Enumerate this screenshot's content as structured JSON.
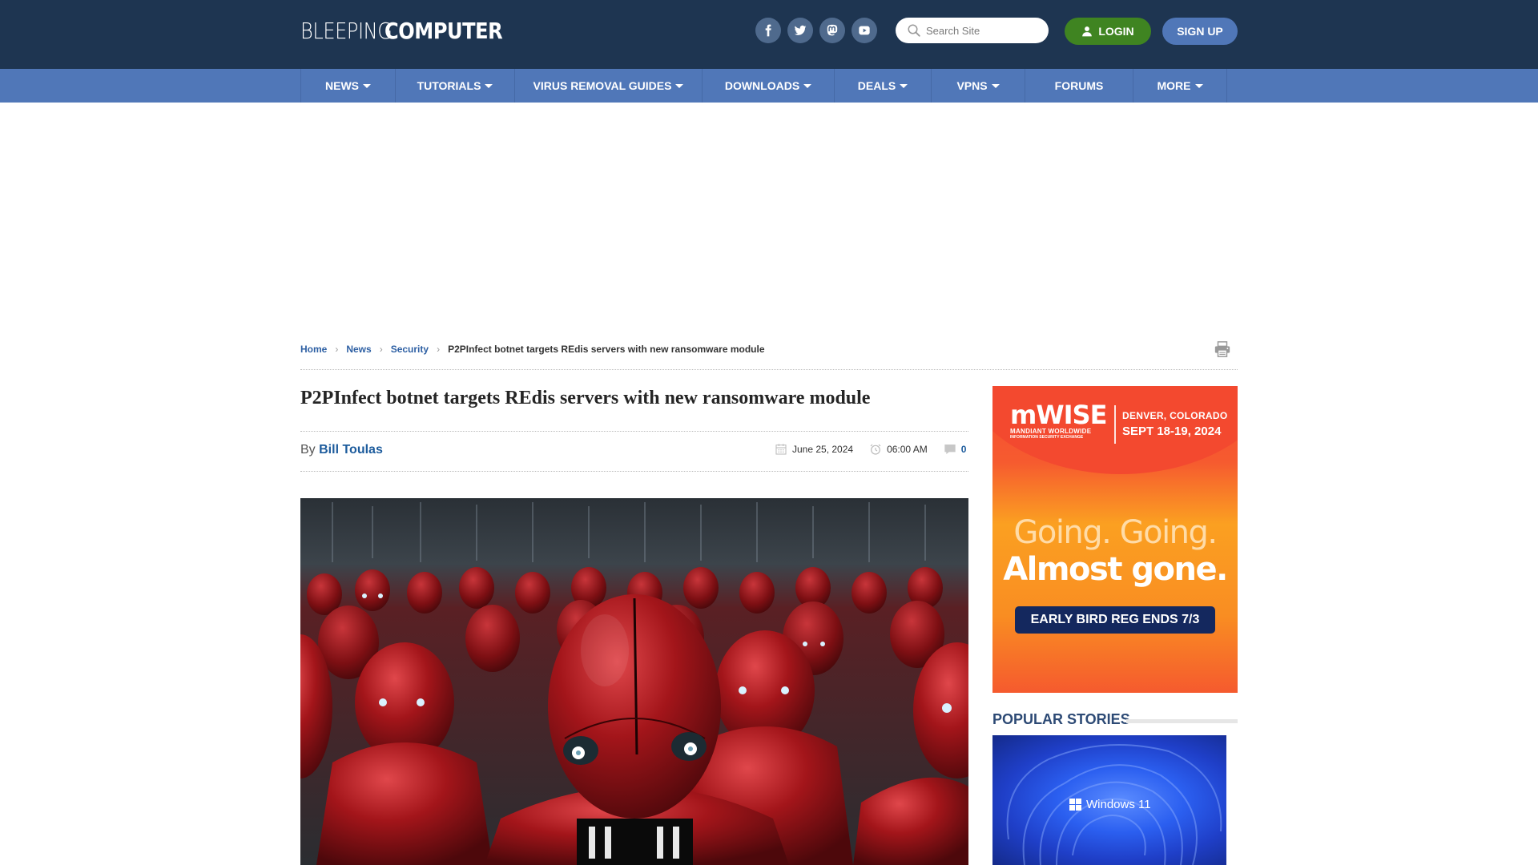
{
  "header": {
    "logo_light": "BLEEPING",
    "logo_bold": "COMPUTER",
    "socials": [
      {
        "name": "facebook",
        "icon": "facebook-icon"
      },
      {
        "name": "twitter",
        "icon": "twitter-icon"
      },
      {
        "name": "mastodon",
        "icon": "mastodon-icon"
      },
      {
        "name": "youtube",
        "icon": "youtube-icon"
      }
    ],
    "search_placeholder": "Search Site",
    "login_label": "LOGIN",
    "signup_label": "SIGN UP"
  },
  "nav": {
    "items": [
      {
        "label": "NEWS",
        "dropdown": true
      },
      {
        "label": "TUTORIALS",
        "dropdown": true
      },
      {
        "label": "VIRUS REMOVAL GUIDES",
        "dropdown": true
      },
      {
        "label": "DOWNLOADS",
        "dropdown": true
      },
      {
        "label": "DEALS",
        "dropdown": true
      },
      {
        "label": "VPNS",
        "dropdown": true
      },
      {
        "label": "FORUMS",
        "dropdown": false
      },
      {
        "label": "MORE",
        "dropdown": true
      }
    ]
  },
  "breadcrumb": {
    "items": [
      "Home",
      "News",
      "Security"
    ],
    "current": "P2PInfect botnet targets REdis servers with new ransomware module"
  },
  "article": {
    "title": "P2PInfect botnet targets REdis servers with new ransomware module",
    "by_label": "By",
    "author": "Bill Toulas",
    "date": "June 25, 2024",
    "time": "06:00 AM",
    "comments": "0",
    "hero_alt": "Red robots army"
  },
  "sidebar": {
    "ad": {
      "brand": "mWISE",
      "brand_sub1": "MANDIANT WORLDWIDE",
      "brand_sub2": "INFORMATION SECURITY EXCHANGE",
      "location": "DENVER, COLORADO",
      "dates": "SEPT 18-19, 2024",
      "headline_1": "Going. Going.",
      "headline_2": "Almost gone.",
      "cta": "EARLY BIRD REG ENDS 7/3"
    },
    "popular_title": "POPULAR STORIES",
    "popular_image_text": "Windows 11"
  },
  "colors": {
    "header_bg": "#1e3551",
    "nav_bg": "#5077b8",
    "login_green": "#3f8421",
    "link_blue": "#1c5b9c",
    "popular_title": "#2d4a75"
  }
}
